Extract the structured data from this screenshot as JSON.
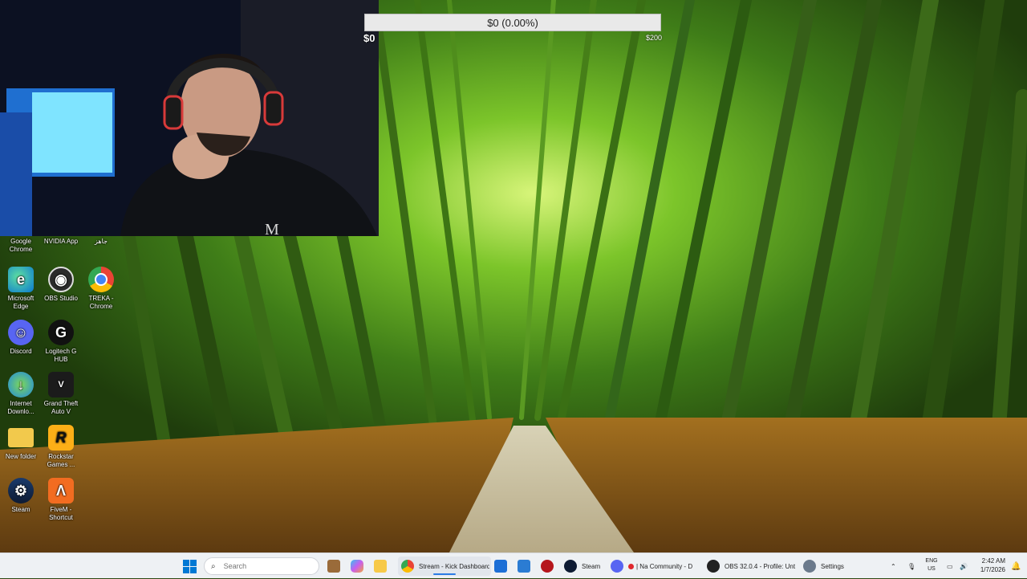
{
  "goal": {
    "current_text": "$0 (0.00%)",
    "min_label": "$0",
    "max_label": "$200",
    "progress_fraction": 0.0
  },
  "desktop_icons": [
    {
      "label": "Google Chrome",
      "icon": "chrome-icon"
    },
    {
      "label": "NVIDIA App",
      "icon": "nvidia-icon"
    },
    {
      "label": "جاهز",
      "icon": "folder-icon"
    },
    {
      "label": "Microsoft Edge",
      "icon": "edge-icon"
    },
    {
      "label": "OBS Studio",
      "icon": "obs-icon"
    },
    {
      "label": "TREKA - Chrome",
      "icon": "chrome-icon"
    },
    {
      "label": "Discord",
      "icon": "discord-icon"
    },
    {
      "label": "Logitech G HUB",
      "icon": "logitech-icon"
    },
    {
      "label": "Internet Downlo...",
      "icon": "idm-icon"
    },
    {
      "label": "Grand Theft Auto V",
      "icon": "gta-icon"
    },
    {
      "label": "New folder",
      "icon": "folder-icon"
    },
    {
      "label": "Rockstar Games ...",
      "icon": "rockstar-icon"
    },
    {
      "label": "Steam",
      "icon": "steam-icon"
    },
    {
      "label": "FiveM - Shortcut",
      "icon": "fivem-icon"
    }
  ],
  "taskbar": {
    "search_placeholder": "Search",
    "apps": [
      {
        "label": "Stream - Kick Dashboard",
        "icon": "chrome-icon"
      },
      {
        "label": "Steam",
        "icon": "steam-icon"
      },
      {
        "label": "| Na Community - D",
        "icon": "discord-icon"
      },
      {
        "label": "OBS 32.0.4 - Profile: Unt",
        "icon": "obs-icon"
      },
      {
        "label": "Settings",
        "icon": "gear-icon"
      }
    ],
    "language": {
      "line1": "ENG",
      "line2": "US"
    },
    "time": "2:42 AM",
    "date": "1/7/2026"
  },
  "colors": {
    "kick_green": "#53fc18",
    "taskbar_bg": "#eef1f4",
    "windows_blue": "#0078d4"
  }
}
